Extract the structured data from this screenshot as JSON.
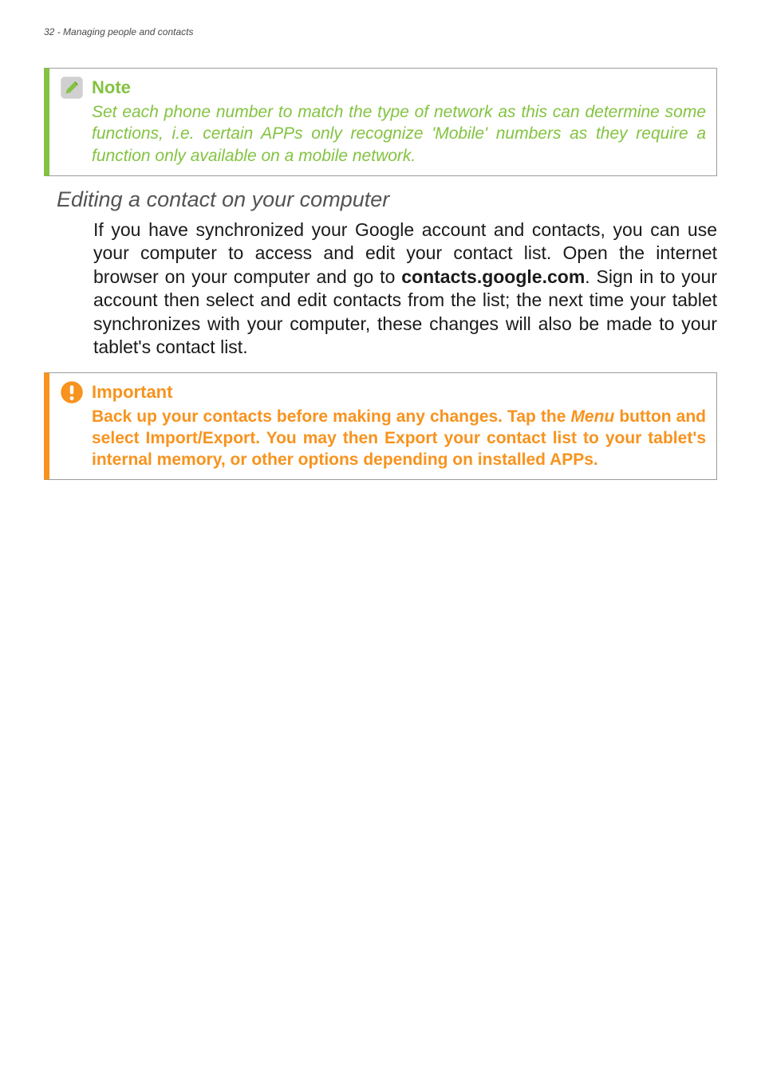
{
  "header": {
    "page_number": "32",
    "section": "Managing people and contacts"
  },
  "note": {
    "title": "Note",
    "body": "Set each phone number to match the type of network as this can determine some functions, i.e. certain APPs only recognize 'Mobile' numbers as they require a function only available on a mobile network."
  },
  "subtitle": "Editing a contact on your computer",
  "paragraph": {
    "part1": "If you have synchronized your Google account and contacts, you can use your computer to access and edit your contact list. Open the internet browser on your computer and go to ",
    "link": "contacts.google.com",
    "part2": ". Sign in to your account then select and edit contacts from the list; the next time your tablet synchronizes with your computer, these changes will also be made to your tablet's contact list."
  },
  "important": {
    "title": "Important",
    "body_pre": "Back up your contacts before making any changes. Tap the ",
    "menu": "Menu",
    "body_post": " button and select Import/Export. You may then Export your contact list to your tablet's internal memory, or other options depending on installed APPs."
  }
}
